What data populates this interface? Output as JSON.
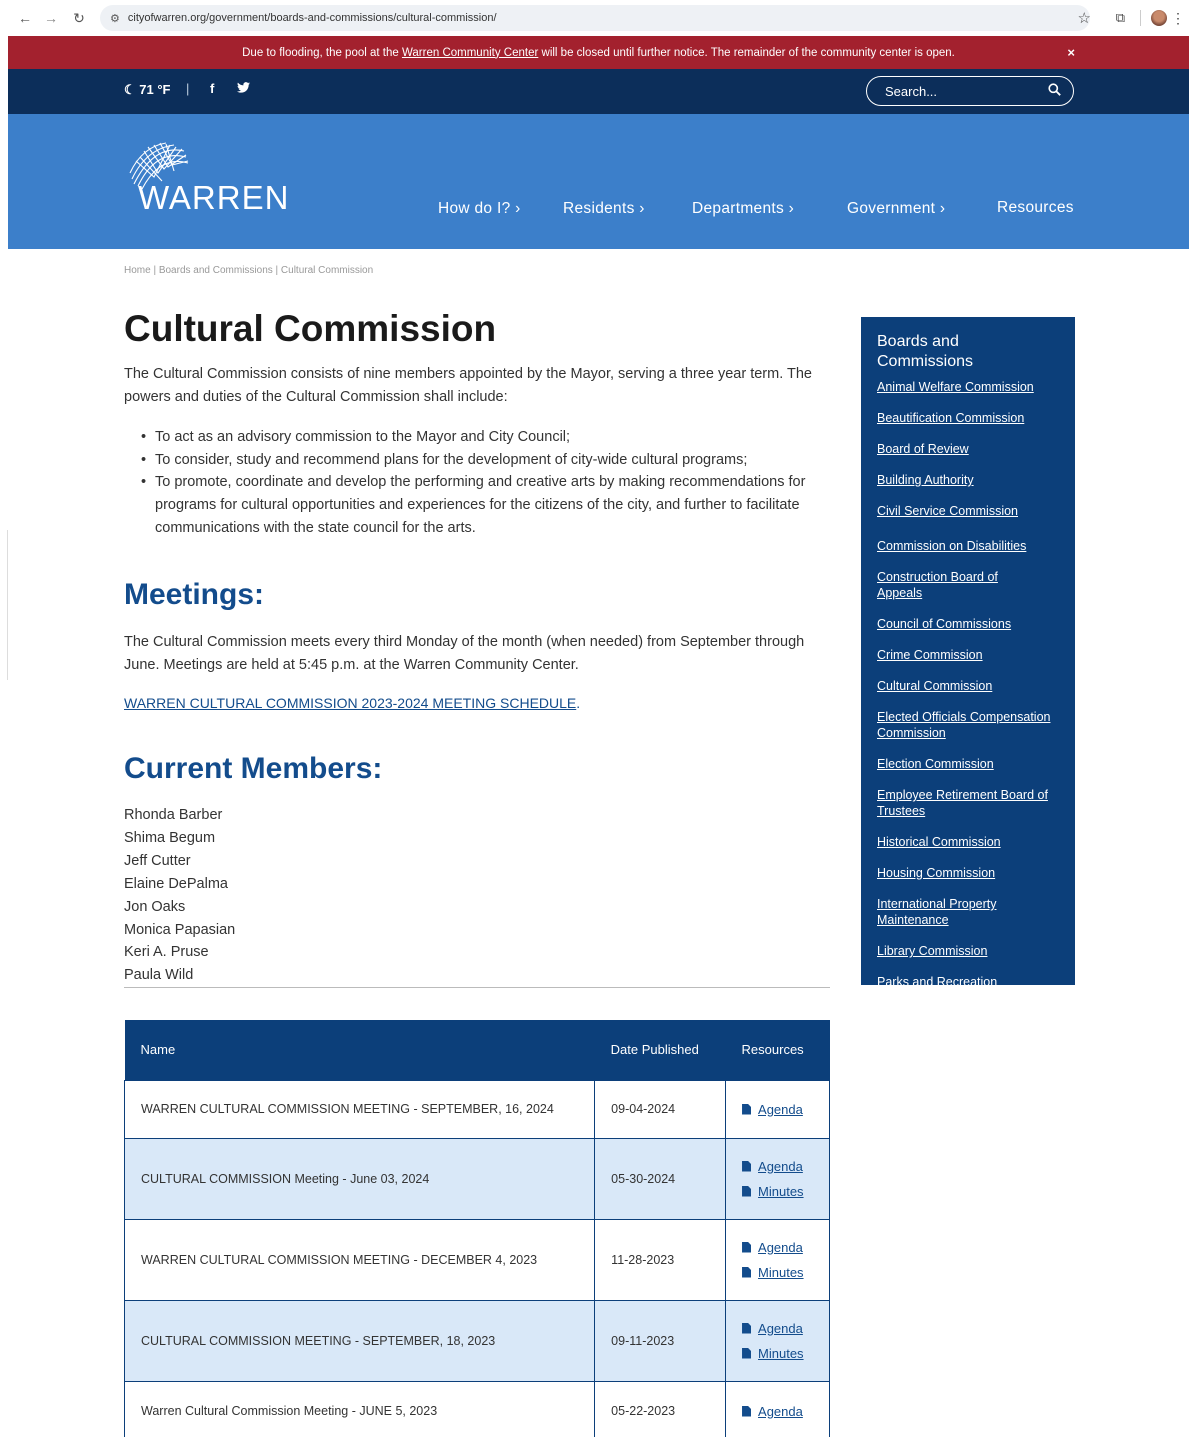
{
  "browser": {
    "url": "cityofwarren.org/government/boards-and-commissions/cultural-commission/"
  },
  "alert": {
    "text_before": "Due to flooding, the pool at the ",
    "link": "Warren Community Center",
    "text_after": " will be closed until further notice. The remainder of the community center is open.",
    "close": "×"
  },
  "utility": {
    "weather": "☾ 71 °F",
    "separator": "|",
    "facebook": "f",
    "twitter": "🐦",
    "search_placeholder": "Search..."
  },
  "header": {
    "logo_text": "WARREN",
    "nav": [
      {
        "label": "How do I?  ›"
      },
      {
        "label": "Residents  ›"
      },
      {
        "label": "Departments  ›"
      },
      {
        "label": "Government  ›"
      },
      {
        "label": "Resources"
      }
    ]
  },
  "breadcrumb": "Home | Boards and Commissions | Cultural Commission",
  "page": {
    "title": "Cultural Commission",
    "intro": "The Cultural Commission consists of nine members appointed by the Mayor, serving a three year term. The powers and duties of the Cultural Commission shall include:",
    "bullets": [
      "To act as an advisory commission to the Mayor and City Council;",
      "To consider, study and recommend plans for the development of city-wide cultural programs;",
      "To promote, coordinate and develop the performing and creative arts by making recommendations for programs for cultural opportunities and experiences for the citizens of the city, and further to facilitate communications with the state council for the arts."
    ],
    "meetings_heading": "Meetings:",
    "meetings_text": "The Cultural Commission meets every third Monday of the month (when needed) from September through June. Meetings are held at 5:45 p.m. at the Warren Community Center.",
    "schedule_link": "WARREN CULTURAL COMMISSION 2023-2024 MEETING SCHEDULE",
    "members_heading": "Current Members:",
    "members": [
      "Rhonda Barber",
      "Shima Begum",
      "Jeff Cutter",
      "Elaine DePalma",
      "Jon Oaks",
      "Monica Papasian",
      "Keri A. Pruse",
      "Paula Wild"
    ]
  },
  "table": {
    "headers": [
      "Name",
      "Date Published",
      "Resources"
    ],
    "rows": [
      {
        "name": "WARREN CULTURAL COMMISSION MEETING - SEPTEMBER, 16, 2024",
        "date": "09-04-2024",
        "resources": [
          "Agenda"
        ]
      },
      {
        "name": "CULTURAL COMMISSION Meeting - June 03, 2024",
        "date": "05-30-2024",
        "resources": [
          "Agenda",
          "Minutes"
        ]
      },
      {
        "name": "WARREN CULTURAL COMMISSION MEETING - DECEMBER 4, 2023",
        "date": "11-28-2023",
        "resources": [
          "Agenda",
          "Minutes"
        ]
      },
      {
        "name": "CULTURAL COMMISSION MEETING - SEPTEMBER, 18, 2023",
        "date": "09-11-2023",
        "resources": [
          "Agenda",
          "Minutes"
        ]
      },
      {
        "name": "Warren Cultural Commission Meeting - JUNE 5, 2023",
        "date": "05-22-2023",
        "resources": [
          "Agenda"
        ]
      }
    ]
  },
  "sidebar": {
    "title": "Boards and Commissions",
    "items": [
      "Animal Welfare Commission",
      "Beautification Commission",
      "Board of Review",
      "Building Authority",
      "Civil Service Commission",
      "Commission on Disabilities",
      "Construction Board of Appeals",
      "Council of Commissions",
      "Crime Commission",
      "Cultural Commission",
      "Elected Officials Compensation Commission",
      "Election Commission",
      "Employee Retirement Board of Trustees",
      "Historical Commission",
      "Housing Commission",
      "International Property Maintenance",
      "Library Commission",
      "Parks and Recreation"
    ]
  }
}
